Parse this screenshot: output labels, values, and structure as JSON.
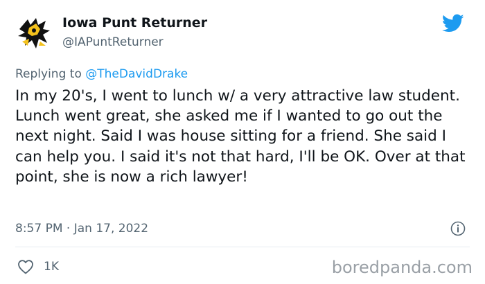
{
  "author": {
    "display_name": "Iowa Punt Returner",
    "handle": "@IAPuntReturner",
    "avatar": "hawkeye-logo-avatar"
  },
  "reply": {
    "prefix": "Replying to ",
    "mention": "@TheDavidDrake"
  },
  "tweet": {
    "text": "In my 20's, I went to lunch w/ a very attractive law student. Lunch went great, she asked me if I wanted to go out the next night. Said I was house sitting for a friend. She said I can help you. I said it's not that hard, I'll be OK. Over at that point, she is now a rich lawyer!",
    "timestamp": "8:57 PM · Jan 17, 2022"
  },
  "actions": {
    "like_count": "1K"
  },
  "icons": {
    "brand": "twitter-bird-icon",
    "info": "info-icon",
    "like": "heart-icon"
  },
  "colors": {
    "twitter_blue": "#1d9bf0",
    "secondary_text": "#536471",
    "hawkeye_gold": "#f4c21d"
  },
  "watermark": {
    "text": "boredpanda.com"
  }
}
